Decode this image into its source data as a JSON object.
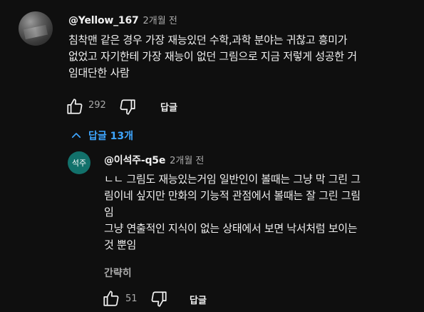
{
  "comment": {
    "author": "@Yellow_167",
    "time": "2개월 전",
    "lines": [
      "침착맨 같은 경우 가장 재능있던 수학,과학 분야는 귀찮고 흥미가",
      "없었고 자기한테 가장 재능이 없던 그림으로 지금 저렇게 성공한 거",
      "임대단한 사람"
    ],
    "like_count": "292",
    "reply_label": "답글",
    "replies_toggle": "답글 13개"
  },
  "reply": {
    "avatar_text": "석주",
    "author": "@이석주-q5e",
    "time": "2개월 전",
    "lines": [
      "ㄴㄴ 그림도 재능있는거임 일반인이 볼때는 그냥 막 그린 그",
      "림이네 싶지만 만화의 기능적 관점에서 볼때는 잘 그린 그림",
      "임",
      "그냥 연출적인 지식이 없는 상태에서 보면 낙서처럼 보이는",
      "것 뿐임"
    ],
    "collapse_label": "간략히",
    "like_count": "51",
    "reply_label": "답글"
  },
  "icons": {
    "like": "thumbs-up-icon",
    "dislike": "thumbs-down-icon",
    "chevron": "chevron-up-icon"
  },
  "colors": {
    "background": "#0f0f0f",
    "text": "#f1f1f1",
    "secondary": "#aaaaaa",
    "link": "#3ea6ff",
    "reply_avatar": "#12716b"
  }
}
